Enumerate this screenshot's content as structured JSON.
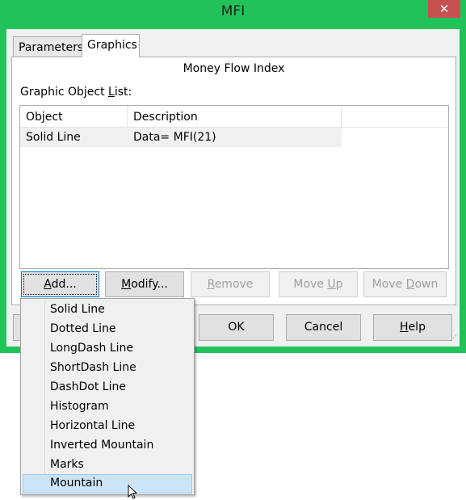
{
  "window": {
    "title": "MFI",
    "close_icon": "close-icon"
  },
  "tabs": [
    {
      "label": "Parameters",
      "active": false
    },
    {
      "label": "Graphics",
      "active": true
    }
  ],
  "panel": {
    "heading": "Money Flow Index",
    "list_label_pre": "Graphic Object ",
    "list_label_u": "L",
    "list_label_post": "ist:"
  },
  "list": {
    "columns": [
      "Object",
      "Description"
    ],
    "rows": [
      {
        "object": "Solid Line",
        "description": "Data= MFI(21)"
      }
    ]
  },
  "buttons": {
    "add": {
      "u": "A",
      "rest": "dd...",
      "enabled": true
    },
    "modify": {
      "u": "M",
      "rest": "odify...",
      "enabled": true
    },
    "remove": {
      "u": "R",
      "rest": "emove",
      "enabled": false
    },
    "move_up": {
      "pre": "Move ",
      "u": "U",
      "rest": "p",
      "enabled": false
    },
    "move_down": {
      "pre": "Move ",
      "u": "D",
      "rest": "own",
      "enabled": false
    }
  },
  "dialog_buttons": {
    "ok": "OK",
    "cancel": "Cancel",
    "help_u": "H",
    "help_rest": "elp"
  },
  "menu": {
    "items": [
      "Solid Line",
      "Dotted Line",
      "LongDash Line",
      "ShortDash Line",
      "DashDot Line",
      "Histogram",
      "Horizontal Line",
      "Inverted Mountain",
      "Marks",
      "Mountain"
    ],
    "highlighted": "Mountain"
  },
  "colors": {
    "border": "#22c25a",
    "close": "#c75050",
    "highlight": "#cce4f7"
  }
}
